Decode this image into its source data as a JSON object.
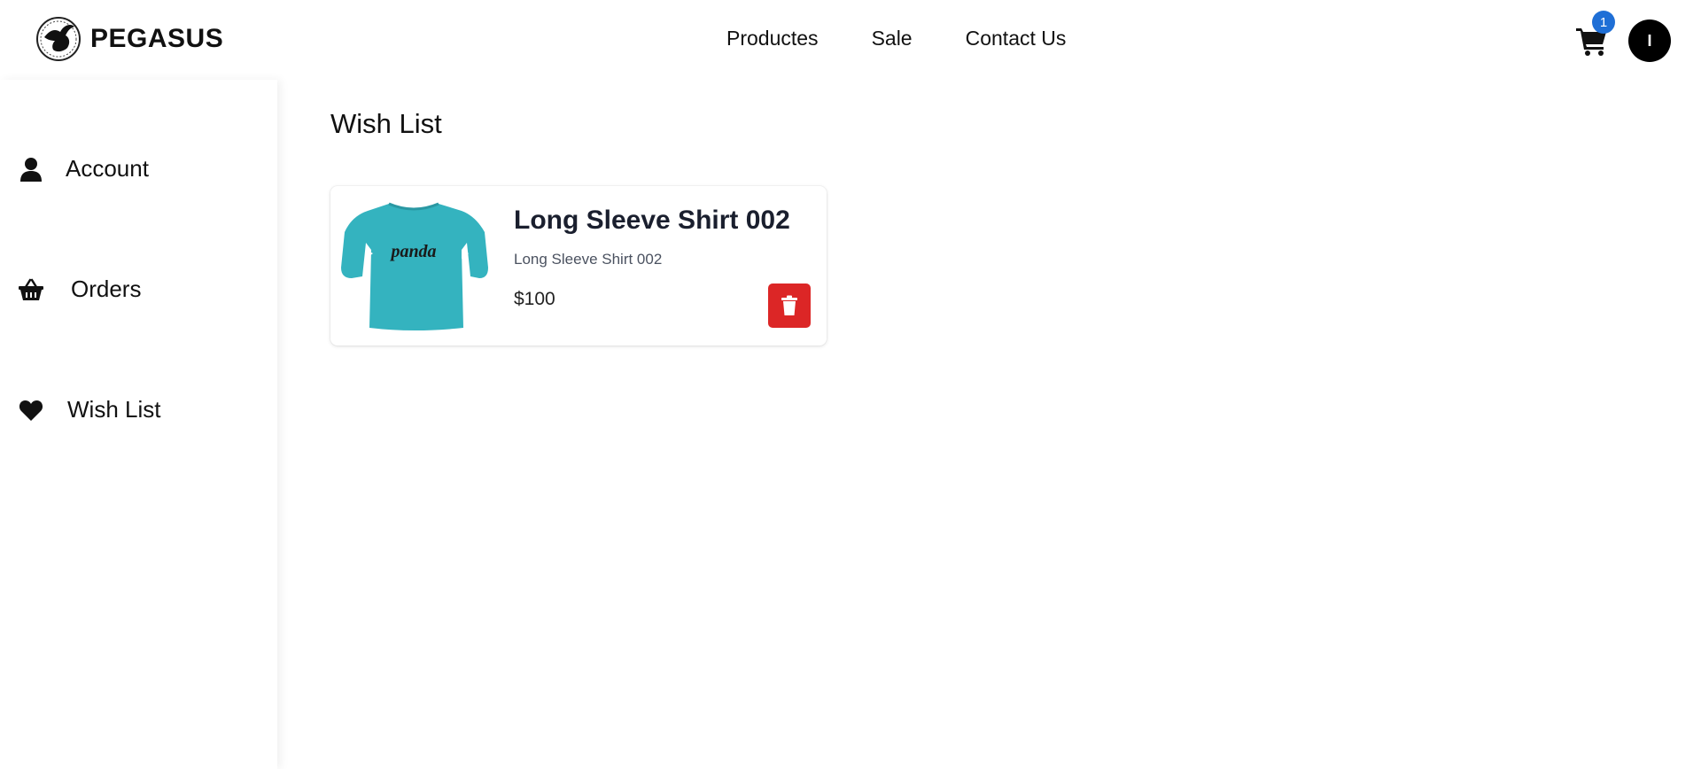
{
  "header": {
    "brand": "PEGASUS",
    "nav": [
      "Productes",
      "Sale",
      "Contact Us"
    ],
    "cart_count": "1",
    "avatar_initial": "I"
  },
  "sidebar": {
    "items": [
      {
        "label": "Account",
        "icon": "user-icon"
      },
      {
        "label": "Orders",
        "icon": "basket-icon"
      },
      {
        "label": "Wish List",
        "icon": "heart-icon"
      }
    ]
  },
  "main": {
    "title": "Wish List",
    "items": [
      {
        "name": "Long Sleeve Shirt 002",
        "description": "Long Sleeve Shirt 002",
        "price": "$100",
        "image_print": "panda",
        "image_color": "#34b3bf"
      }
    ]
  },
  "colors": {
    "delete": "#dc2626",
    "badge": "#1f6fd6"
  }
}
